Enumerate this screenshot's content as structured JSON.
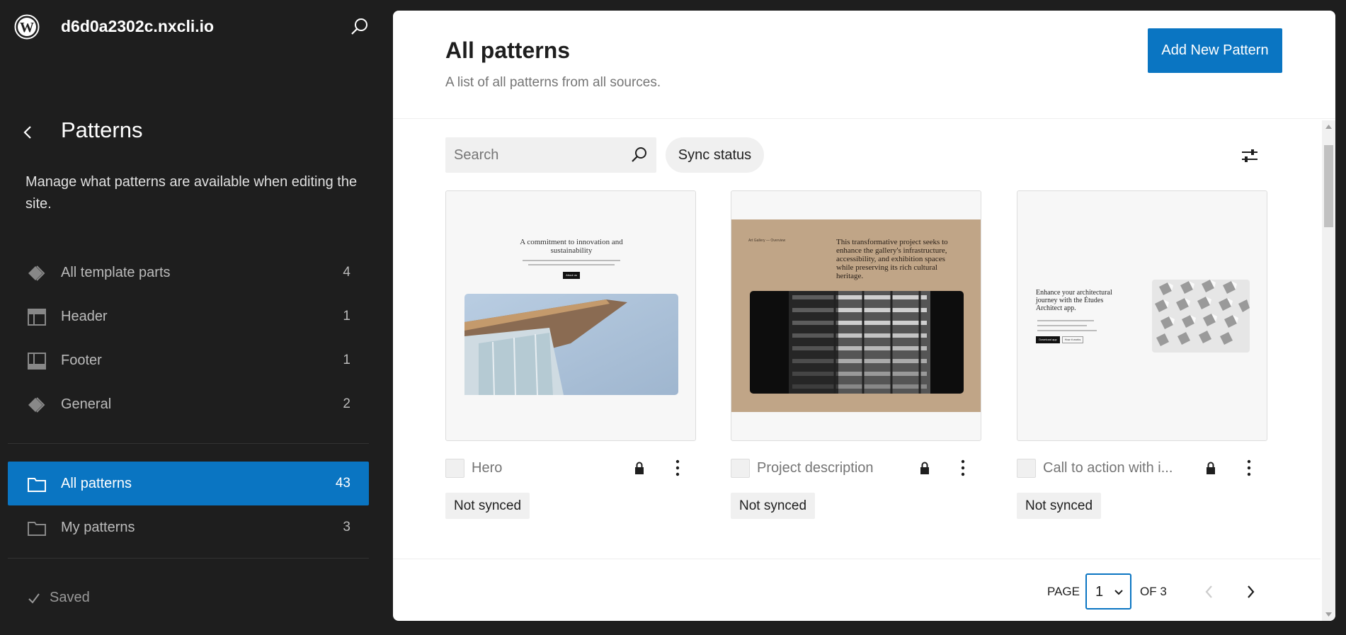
{
  "site": {
    "name": "d6d0a2302c.nxcli.io"
  },
  "sidebar": {
    "title": "Patterns",
    "description": "Manage what patterns are available when editing the site.",
    "template_items": [
      {
        "label": "All template parts",
        "count": "4",
        "icon": "diamond-icon"
      },
      {
        "label": "Header",
        "count": "1",
        "icon": "header-layout-icon"
      },
      {
        "label": "Footer",
        "count": "1",
        "icon": "footer-layout-icon"
      },
      {
        "label": "General",
        "count": "2",
        "icon": "diamond-icon"
      }
    ],
    "pattern_items": [
      {
        "label": "All patterns",
        "count": "43",
        "icon": "folder-icon",
        "active": true
      },
      {
        "label": "My patterns",
        "count": "3",
        "icon": "folder-icon",
        "active": false
      }
    ],
    "status": "Saved"
  },
  "main": {
    "title": "All patterns",
    "subtitle": "A list of all patterns from all sources.",
    "add_button": "Add New Pattern",
    "search_placeholder": "Search",
    "sync_filter": "Sync status",
    "cards": [
      {
        "title": "Hero",
        "badge": "Not synced",
        "preview_heading": "A commitment to innovation and sustainability",
        "preview_button": "About us"
      },
      {
        "title": "Project description",
        "badge": "Not synced",
        "preview_small": "Art Gallery — Overview",
        "preview_heading": "This transformative project seeks to enhance the gallery's infrastructure, accessibility, and exhibition spaces while preserving its rich cultural heritage."
      },
      {
        "title": "Call to action with i...",
        "badge": "Not synced",
        "preview_heading": "Enhance your architectural journey with the Études Architect app.",
        "preview_button_1": "Download app",
        "preview_button_2": "How it works"
      }
    ],
    "pagination": {
      "page_label": "PAGE",
      "current": "1",
      "of_label": "OF 3"
    }
  },
  "colors": {
    "accent": "#0a75c2",
    "sidebar_bg": "#1e1e1e",
    "preview_tan": "#c0a587"
  }
}
